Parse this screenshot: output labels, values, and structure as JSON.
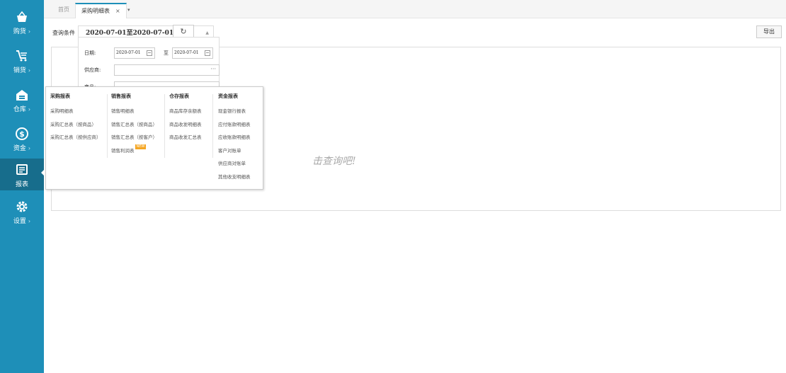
{
  "sidebar": {
    "items": [
      {
        "label": "购货",
        "icon": "basket-icon"
      },
      {
        "label": "销货",
        "icon": "cart-icon"
      },
      {
        "label": "仓库",
        "icon": "warehouse-icon"
      },
      {
        "label": "资金",
        "icon": "money-icon"
      },
      {
        "label": "报表",
        "icon": "report-icon"
      },
      {
        "label": "设置",
        "icon": "gear-icon"
      }
    ],
    "arrow": "›",
    "active_index": 4,
    "background_color": "#1e8fb8"
  },
  "tabs": {
    "home": "首页",
    "active": "采购明细表",
    "close": "×",
    "dropdown": "▾"
  },
  "toolbar": {
    "query_label": "查询条件",
    "date_range": "2020-07-01至2020-07-01",
    "refresh_icon": "↻",
    "export": "导出"
  },
  "filter": {
    "date_label": "日期:",
    "date_from": "2020-07-01",
    "to_label": "至",
    "date_to": "2020-07-01",
    "supplier_label": "供应商:",
    "more": "···",
    "product_label": "商品:"
  },
  "hint": "击查询吧!",
  "report_menu": {
    "columns": [
      {
        "title": "采购报表",
        "items": [
          "采购明细表",
          "采购汇总表（按商品）",
          "采购汇总表（按供应商）"
        ]
      },
      {
        "title": "销售报表",
        "items": [
          "销售明细表",
          "销售汇总表（按商品）",
          "销售汇总表（按客户）",
          "销售利润表"
        ]
      },
      {
        "title": "仓存报表",
        "items": [
          "商品库存余额表",
          "商品收发明细表",
          "商品收发汇总表"
        ]
      },
      {
        "title": "资金报表",
        "items": [
          "现金银行报表",
          "应付账款明细表",
          "应收账款明细表",
          "客户对账单",
          "供应商对账单",
          "其他收支明细表"
        ]
      }
    ],
    "new_badge": "NEW"
  }
}
